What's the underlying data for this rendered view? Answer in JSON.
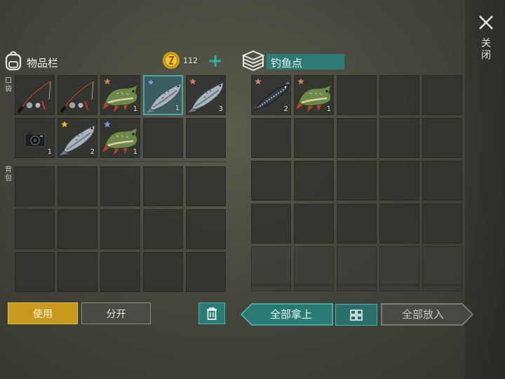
{
  "inventory": {
    "title": "物品栏",
    "coins": "112",
    "pocket_label": "口袋",
    "backpack_label": "背包",
    "pocket_slots": [
      {
        "item": "fishing-rod",
        "count": "",
        "star": "",
        "selected": false
      },
      {
        "item": "fishing-rod",
        "count": "",
        "star": "",
        "selected": false
      },
      {
        "item": "pike",
        "count": "1",
        "star": "bronze",
        "selected": false
      },
      {
        "item": "salmon",
        "count": "1",
        "star": "blue",
        "selected": true
      },
      {
        "item": "salmon",
        "count": "3",
        "star": "bronze",
        "selected": false
      },
      {
        "item": "camera",
        "count": "1",
        "star": "",
        "selected": false
      },
      {
        "item": "salmon",
        "count": "2",
        "star": "gold",
        "selected": false
      },
      {
        "item": "pike",
        "count": "1",
        "star": "blue",
        "selected": false
      },
      {
        "item": "",
        "count": "",
        "star": "",
        "selected": false
      },
      {
        "item": "",
        "count": "",
        "star": "",
        "selected": false
      }
    ],
    "use_label": "使用",
    "split_label": "分开"
  },
  "fishing_spot": {
    "title": "钓鱼点",
    "slots": [
      {
        "item": "sturgeon",
        "count": "2",
        "star": "bronze"
      },
      {
        "item": "pike",
        "count": "1",
        "star": "bronze"
      }
    ],
    "take_all_label": "全部拿上",
    "put_all_label": "全部放入"
  },
  "close_label": "关闭",
  "colors": {
    "accent_teal": "#2fa39c",
    "use_button": "#c79a1e",
    "star_bronze": "#d2826a",
    "star_blue": "#7f9bd6",
    "star_gold": "#e8c21c"
  }
}
